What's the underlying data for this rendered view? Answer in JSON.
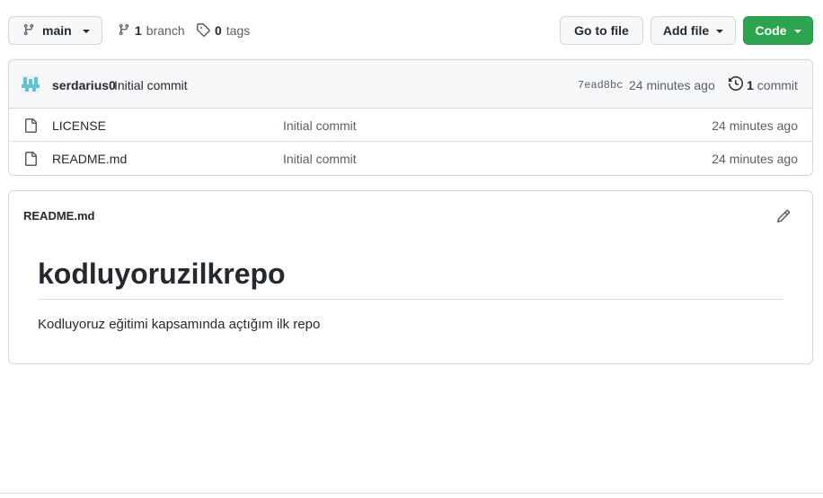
{
  "topbar": {
    "branch_label": "main",
    "branch_count": "1",
    "branch_word": "branch",
    "tag_count": "0",
    "tag_word": "tags",
    "go_to_file": "Go to file",
    "add_file": "Add file",
    "code": "Code"
  },
  "commit": {
    "author": "serdarius0",
    "message": "Initial commit",
    "sha": "7ead8bc",
    "time": "24 minutes ago",
    "count": "1",
    "count_word": "commit"
  },
  "files": [
    {
      "name": "LICENSE",
      "message": "Initial commit",
      "time": "24 minutes ago"
    },
    {
      "name": "README.md",
      "message": "Initial commit",
      "time": "24 minutes ago"
    }
  ],
  "readme": {
    "filename": "README.md",
    "heading": "kodluyoruzilkrepo",
    "paragraph": "Kodluyoruz eğitimi kapsamında açtığım ilk repo"
  },
  "colors": {
    "accent_green": "#2da44e",
    "avatar_teal": "#63c2cf"
  }
}
